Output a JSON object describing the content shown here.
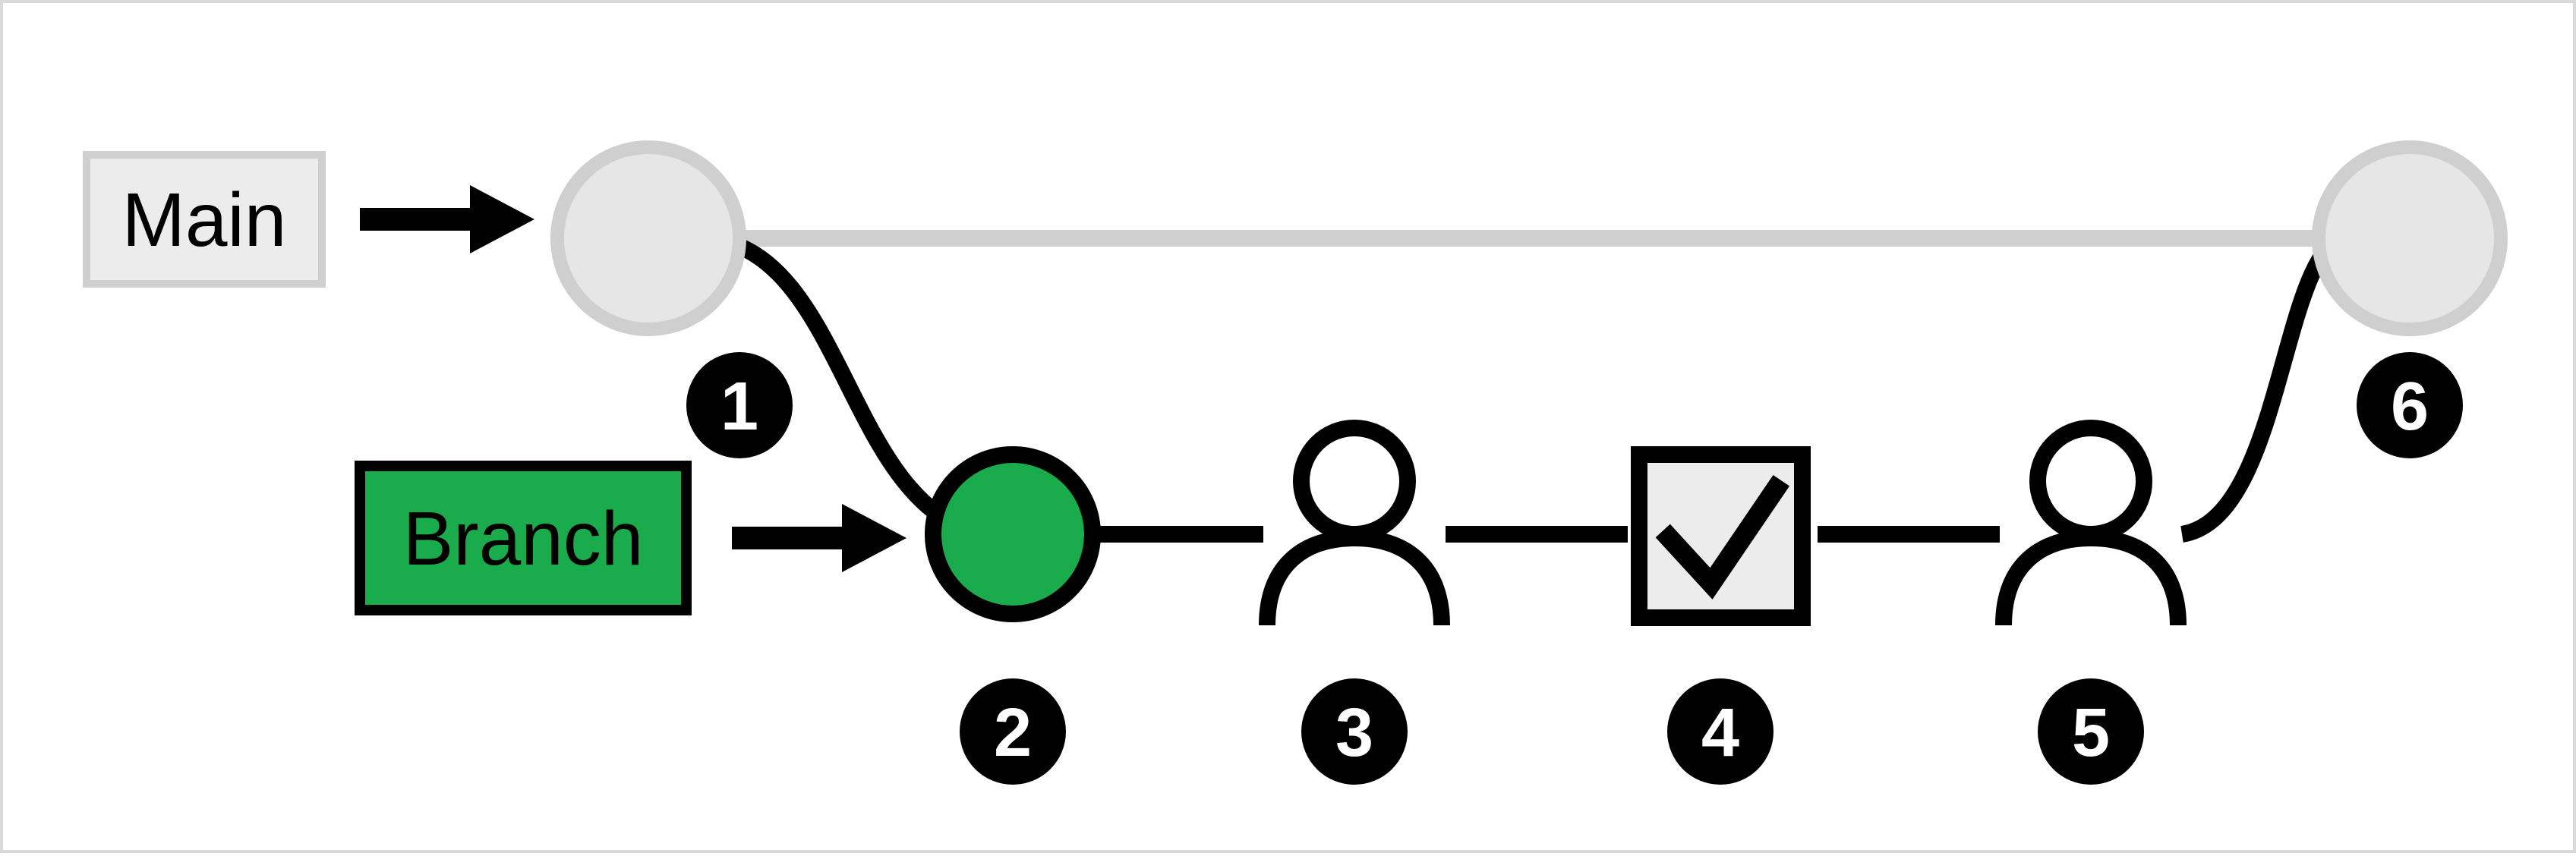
{
  "labels": {
    "main": "Main",
    "branch": "Branch"
  },
  "steps": {
    "s1": "1",
    "s2": "2",
    "s3": "3",
    "s4": "4",
    "s5": "5",
    "s6": "6"
  },
  "colors": {
    "muted": "#e6e6e6",
    "mutedStroke": "#cfcfcf",
    "black": "#000000",
    "green": "#1aab4c",
    "white": "#ffffff",
    "frameBorder": "#d9d9d9"
  }
}
